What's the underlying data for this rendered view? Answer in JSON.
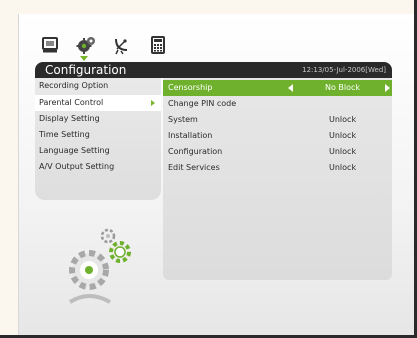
{
  "toolbar": {
    "icons": [
      "tv-icon",
      "settings-gears-icon",
      "satellite-dish-icon",
      "calculator-icon"
    ],
    "selected": "settings-gears-icon"
  },
  "header": {
    "title": "Configuration",
    "clock": "12:13/05-Jul-2006[Wed]"
  },
  "menu": {
    "items": [
      {
        "label": "Recording Option"
      },
      {
        "label": "Parental Control"
      },
      {
        "label": "Display Setting"
      },
      {
        "label": "Time Setting"
      },
      {
        "label": "Language Setting"
      },
      {
        "label": "A/V Output Setting"
      }
    ],
    "selected": "Parental Control"
  },
  "parental": {
    "rows": [
      {
        "label": "Censorship",
        "value": "No Block"
      },
      {
        "label": "Change PIN code",
        "value": ""
      },
      {
        "label": "System",
        "value": "Unlock"
      },
      {
        "label": "Installation",
        "value": "Unlock"
      },
      {
        "label": "Configuration",
        "value": "Unlock"
      },
      {
        "label": "Edit Services",
        "value": "Unlock"
      }
    ]
  },
  "colors": {
    "accent_green": "#6fb12c",
    "header_bg": "#2a2a2a",
    "panel_bg": "#e4e4e4"
  }
}
